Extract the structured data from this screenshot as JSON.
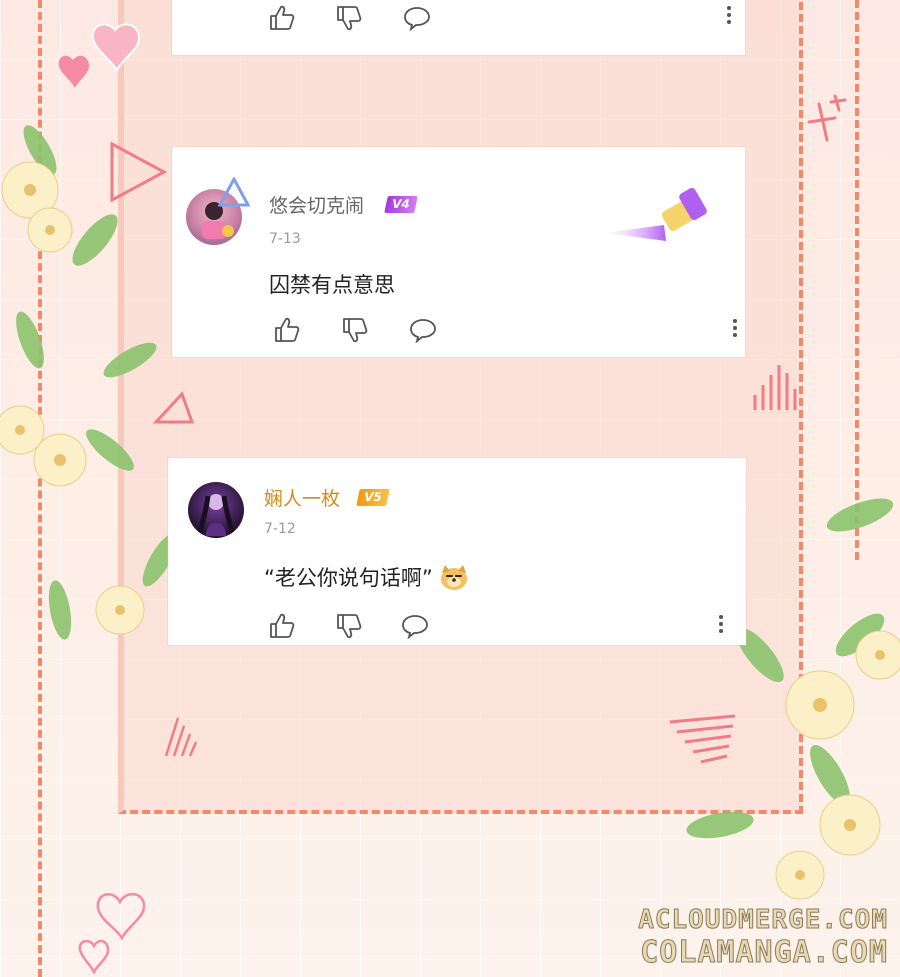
{
  "colors": {
    "background": "#fdeee6",
    "frame_dash": "#f08a6a",
    "card": "#ffffff",
    "username_normal": "#666666",
    "username_vip": "#d88a1c",
    "badge_v4": "#b94be0",
    "badge_v5": "#f2a51d"
  },
  "comments": [
    {
      "username": "",
      "date": "",
      "text": ""
    },
    {
      "username": "悠会切克闹",
      "level_badge": "V4",
      "date": "7-13",
      "text": "囚禁有点意思"
    },
    {
      "username": "娴人一枚",
      "level_badge": "V5",
      "date": "7-12",
      "text": "“老公你说句话啊”",
      "emoji": "dog-face-icon"
    }
  ],
  "icons": {
    "like": "thumbs-up-icon",
    "dislike": "thumbs-down-icon",
    "reply": "speech-bubble-icon",
    "more": "more-vertical-icon"
  },
  "watermark": {
    "line1": "ACLOUDMERGE.COM",
    "line2": "COLAMANGA.COM"
  }
}
